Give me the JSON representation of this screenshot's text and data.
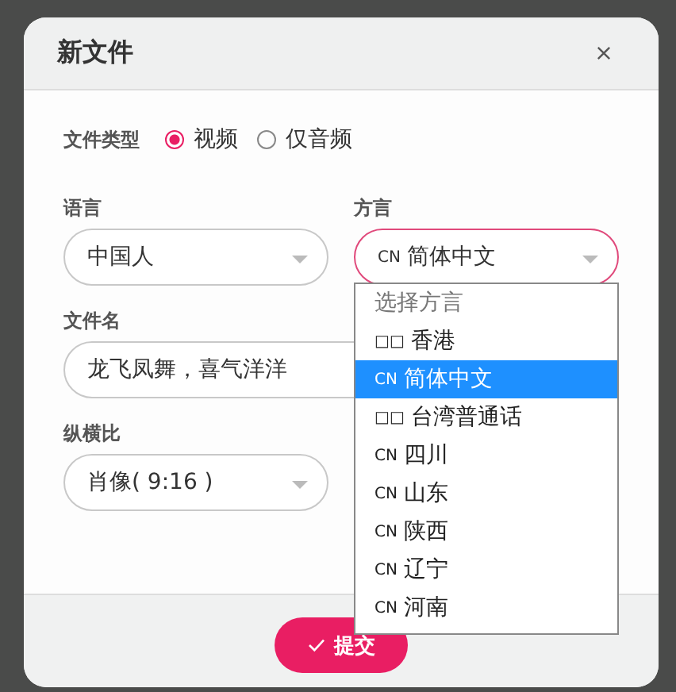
{
  "dialog": {
    "title": "新文件"
  },
  "file_type": {
    "label": "文件类型",
    "options": [
      {
        "label": "视频",
        "selected": true
      },
      {
        "label": "仅音频",
        "selected": false
      }
    ]
  },
  "language": {
    "label": "语言",
    "value": "中国人"
  },
  "dialect": {
    "label": "方言",
    "value": {
      "code": "CN",
      "name": "简体中文"
    },
    "expanded": true,
    "options": [
      {
        "kind": "header",
        "name": "选择方言",
        "selected": false
      },
      {
        "kind": "option",
        "code": "□□",
        "name": "香港",
        "selected": false
      },
      {
        "kind": "option",
        "code": "CN",
        "name": "简体中文",
        "selected": true
      },
      {
        "kind": "option",
        "code": "□□",
        "name": "台湾普通话",
        "selected": false
      },
      {
        "kind": "option",
        "code": "CN",
        "name": "四川",
        "selected": false
      },
      {
        "kind": "option",
        "code": "CN",
        "name": "山东",
        "selected": false
      },
      {
        "kind": "option",
        "code": "CN",
        "name": "陕西",
        "selected": false
      },
      {
        "kind": "option",
        "code": "CN",
        "name": "辽宁",
        "selected": false
      },
      {
        "kind": "option",
        "code": "CN",
        "name": "河南",
        "selected": false
      }
    ]
  },
  "file_name": {
    "label": "文件名",
    "value": "龙飞凤舞，喜气洋洋"
  },
  "aspect_ratio": {
    "label": "纵横比",
    "value": "肖像( 9:16 )"
  },
  "submit_button": {
    "label": "提交"
  }
}
